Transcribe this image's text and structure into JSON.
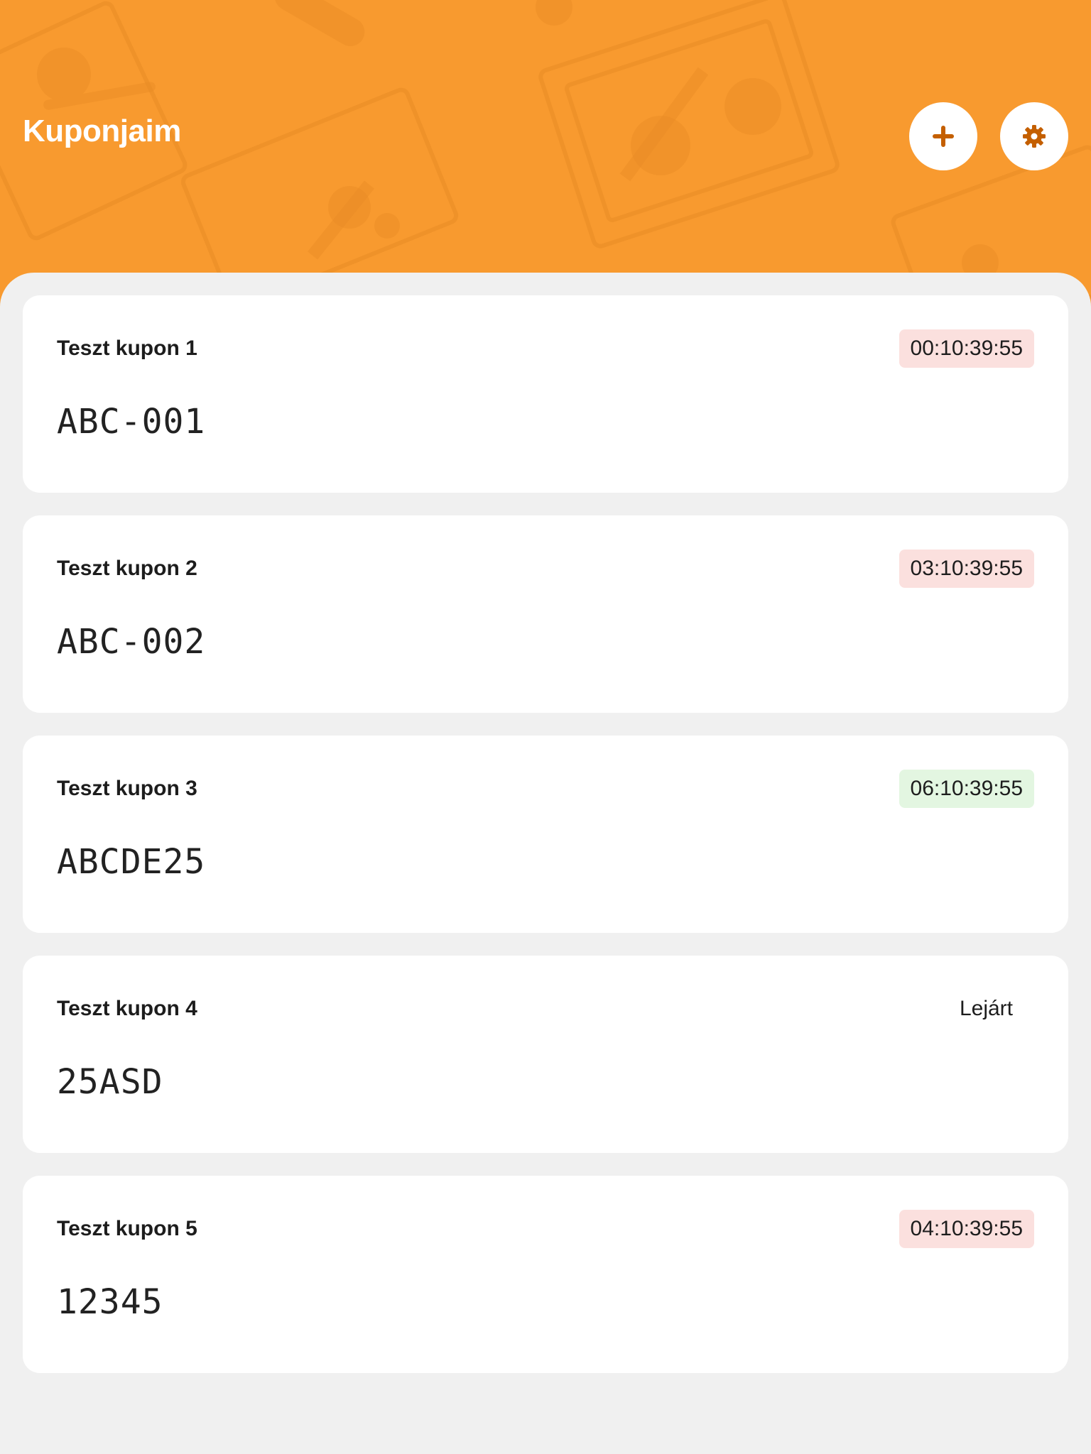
{
  "header": {
    "title": "Kuponjaim",
    "add_icon": "plus-icon",
    "settings_icon": "gear-icon",
    "background_color": "#f89a2f",
    "icon_color": "#c45f00"
  },
  "coupons": [
    {
      "title": "Teszt kupon 1",
      "status": "00:10:39:55",
      "status_color": "#fbe0de",
      "code": "ABC-001"
    },
    {
      "title": "Teszt kupon 2",
      "status": "03:10:39:55",
      "status_color": "#fbe0de",
      "code": "ABC-002"
    },
    {
      "title": "Teszt kupon 3",
      "status": "06:10:39:55",
      "status_color": "#e3f6e1",
      "code": "ABCDE25"
    },
    {
      "title": "Teszt kupon 4",
      "status": "Lejárt",
      "status_color": "transparent",
      "code": "25ASD"
    },
    {
      "title": "Teszt kupon 5",
      "status": "04:10:39:55",
      "status_color": "#fbe0de",
      "code": "12345"
    }
  ]
}
